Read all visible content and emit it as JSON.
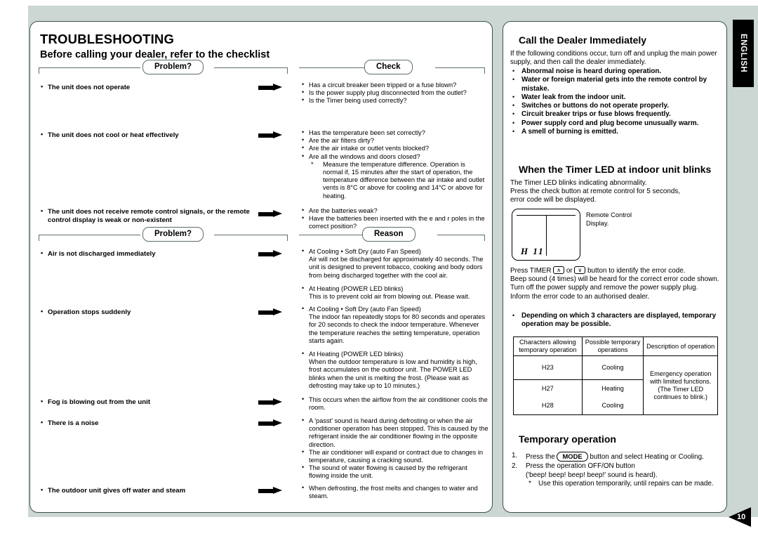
{
  "page": {
    "language_tab": "ENGLISH",
    "page_number": "10",
    "background_color": "#ccd7d4"
  },
  "left": {
    "title": "TROUBLESHOOTING",
    "subtitle": "Before calling your dealer, refer to the checklist",
    "chips": {
      "problem1": "Problem?",
      "check": "Check",
      "problem2": "Problem?",
      "reason": "Reason"
    },
    "table1": {
      "problems": [
        "The unit does not operate",
        "The unit does not cool or heat effectively",
        "The unit does not receive remote control signals, or the remote control display is weak or non-existent"
      ],
      "checks_group1": [
        "Has a circuit breaker been tripped or a fuse blown?",
        "Is the power supply plug disconnected from the outlet?",
        "Is the Timer being used correctly?"
      ],
      "checks_group2": [
        "Has the temperature been set correctly?",
        "Are the air filters dirty?",
        "Are the air intake or outlet vents blocked?",
        "Are all the windows and doors closed?"
      ],
      "checks_group2_note": "Measure the temperature difference. Operation is normal if, 15 minutes after  the start of operation, the temperature difference between the air intake and outlet vents is 8°C or above for cooling and 14°C or above for heating.",
      "checks_group3": [
        "Are the batteries weak?",
        "Have the batteries been inserted with the e  and r   poles in the correct position?"
      ]
    },
    "table2": {
      "problems": [
        "Air is not discharged immediately",
        "Operation stops suddenly",
        "Fog is blowing out from the unit",
        "There is a noise",
        "The outdoor unit gives off water and steam"
      ],
      "reasons_group1": [
        {
          "head": "At Cooling • Soft Dry (auto Fan Speed)",
          "body": "Air will not be discharged for approximately 40 seconds. The unit is designed to prevent tobacco, cooking and body odors from being discharged  together with the cool air."
        },
        {
          "head": "At Heating (POWER LED blinks)",
          "body": "This is to prevent cold air from blowing out. Please wait."
        }
      ],
      "reasons_group2": [
        {
          "head": "At Cooling • Soft Dry (auto Fan Speed)",
          "body": "The indoor fan repeatedly stops for 80 seconds and operates for 20 seconds to check the indoor temperature. Whenever the temperature reaches the setting temperature, operation starts again."
        },
        {
          "head": "At Heating (POWER LED blinks)",
          "body": "When the outdoor temperature is low and humidity is high, frost accumulates on the outdoor unit. The POWER LED blinks when the unit is melting the frost. (Please wait as defrosting may take up to 10 minutes.)"
        }
      ],
      "reasons_group3": [
        "This occurs when the airflow from the air conditioner cools the room."
      ],
      "reasons_group4": [
        "A 'passt' sound is heard during defrosting or when the air conditioner operation has been stopped. This is caused by the refrigerant inside the air conditioner flowing in the opposite direction.",
        "The air conditioner will expand or contract due to changes in temperature, causing a cracking sound.",
        "The sound of water flowing is caused by the refrigerant flowing inside the unit."
      ],
      "reasons_group5": [
        "When defrosting, the frost melts and changes to water and steam."
      ]
    }
  },
  "right": {
    "dealer": {
      "heading": "Call the Dealer Immediately",
      "intro": "If the following conditions occur, turn off and unplug the main power supply, and then call the dealer immediately.",
      "items": [
        "Abnormal noise is heard during operation.",
        "Water or foreign material gets into the remote control by mistake.",
        "Water leak from the indoor unit.",
        "Switches or buttons do not operate properly.",
        "Circuit breaker trips or fuse blows frequently.",
        "Power supply cord and plug become unusually warm.",
        "A smell of burning is emitted."
      ]
    },
    "timer_led": {
      "heading": "When the Timer LED at indoor unit blinks",
      "intro_line1": "The Timer LED blinks indicating abnormality.",
      "intro_line2": "Press the check button at remote control for 5 seconds,",
      "intro_line3": "error code will be displayed.",
      "display_code": "H 11",
      "display_label_line1": "Remote Control",
      "display_label_line2": "Display.",
      "press_timer_pre": "Press TIMER",
      "press_timer_up": "∧",
      "press_timer_or": "or",
      "press_timer_down": "∨",
      "press_timer_post": "button to identify the error code.",
      "line_beep": "Beep sound (4 times) will be heard for the correct error code shown.",
      "line_turnoff": "Turn off the power supply and remove the power supply plug.",
      "line_inform": "Inform the error code to an authorised dealer.",
      "bold_note": "Depending on which 3 characters are displayed, temporary operation may be possible."
    },
    "code_table": {
      "headers": [
        "Characters allowing temporary operation",
        "Possible temporary operations",
        "Description of operation"
      ],
      "rows": [
        {
          "code": "H23",
          "operation": "Cooling"
        },
        {
          "code": "H27",
          "operation": "Heating"
        },
        {
          "code": "H28",
          "operation": "Cooling"
        }
      ],
      "description": "Emergency operation with limited  functions. (The Timer LED continues to blink.)"
    },
    "temporary": {
      "heading": "Temporary operation",
      "step1_num": "1.",
      "step1_pre": "Press the",
      "step1_key": "MODE",
      "step1_post": "button and select Heating or Cooling.",
      "step2_num": "2.",
      "step2_line1": "Press the operation OFF/ON button",
      "step2_line2": "('beep! beep! beep! beep!' sound is heard).",
      "step2_note": "Use this operation temporarily, until repairs can be made."
    }
  }
}
